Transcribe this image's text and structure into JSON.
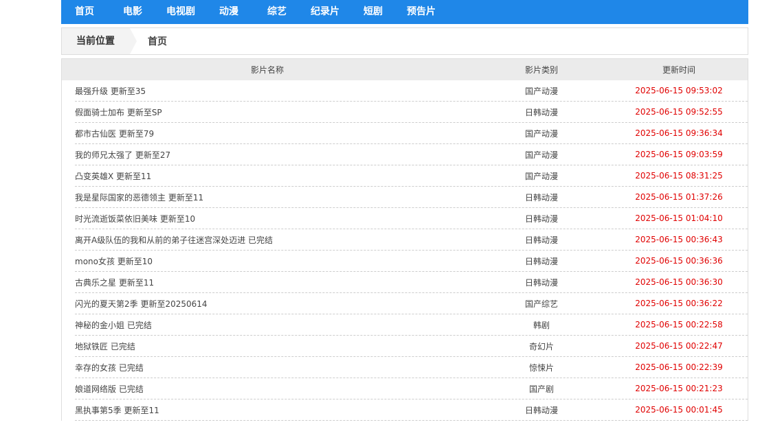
{
  "nav": {
    "items": [
      {
        "label": "首页"
      },
      {
        "label": "电影"
      },
      {
        "label": "电视剧"
      },
      {
        "label": "动漫"
      },
      {
        "label": "综艺"
      },
      {
        "label": "纪录片"
      },
      {
        "label": "短剧"
      },
      {
        "label": "预告片"
      }
    ]
  },
  "breadcrumb": {
    "label": "当前位置",
    "home": "首页"
  },
  "table": {
    "headers": {
      "name": "影片名称",
      "type": "影片类别",
      "time": "更新时间"
    },
    "rows": [
      {
        "name": "最强升级 更新至35",
        "type": "国产动漫",
        "time": "2025-06-15 09:53:02"
      },
      {
        "name": "假面骑士加布 更新至SP",
        "type": "日韩动漫",
        "time": "2025-06-15 09:52:55"
      },
      {
        "name": "都市古仙医 更新至79",
        "type": "国产动漫",
        "time": "2025-06-15 09:36:34"
      },
      {
        "name": "我的师兄太强了 更新至27",
        "type": "国产动漫",
        "time": "2025-06-15 09:03:59"
      },
      {
        "name": "凸变英雄X 更新至11",
        "type": "国产动漫",
        "time": "2025-06-15 08:31:25"
      },
      {
        "name": "我是星际国家的恶德领主 更新至11",
        "type": "日韩动漫",
        "time": "2025-06-15 01:37:26"
      },
      {
        "name": "时光流逝饭菜依旧美味 更新至10",
        "type": "日韩动漫",
        "time": "2025-06-15 01:04:10"
      },
      {
        "name": "离开A级队伍的我和从前的弟子往迷宫深处迈进 已完结",
        "type": "日韩动漫",
        "time": "2025-06-15 00:36:43"
      },
      {
        "name": "mono女孩 更新至10",
        "type": "日韩动漫",
        "time": "2025-06-15 00:36:36"
      },
      {
        "name": "古典乐之星 更新至11",
        "type": "日韩动漫",
        "time": "2025-06-15 00:36:30"
      },
      {
        "name": "闪光的夏天第2季 更新至20250614",
        "type": "国产综艺",
        "time": "2025-06-15 00:36:22"
      },
      {
        "name": "神秘的金小姐 已完结",
        "type": "韩剧",
        "time": "2025-06-15 00:22:58"
      },
      {
        "name": "地狱铁匠 已完结",
        "type": "奇幻片",
        "time": "2025-06-15 00:22:47"
      },
      {
        "name": "幸存的女孩 已完结",
        "type": "惊悚片",
        "time": "2025-06-15 00:22:39"
      },
      {
        "name": "娘道网络版 已完结",
        "type": "国产剧",
        "time": "2025-06-15 00:21:23"
      },
      {
        "name": "黑执事第5季 更新至11",
        "type": "日韩动漫",
        "time": "2025-06-15 00:01:45"
      }
    ]
  }
}
